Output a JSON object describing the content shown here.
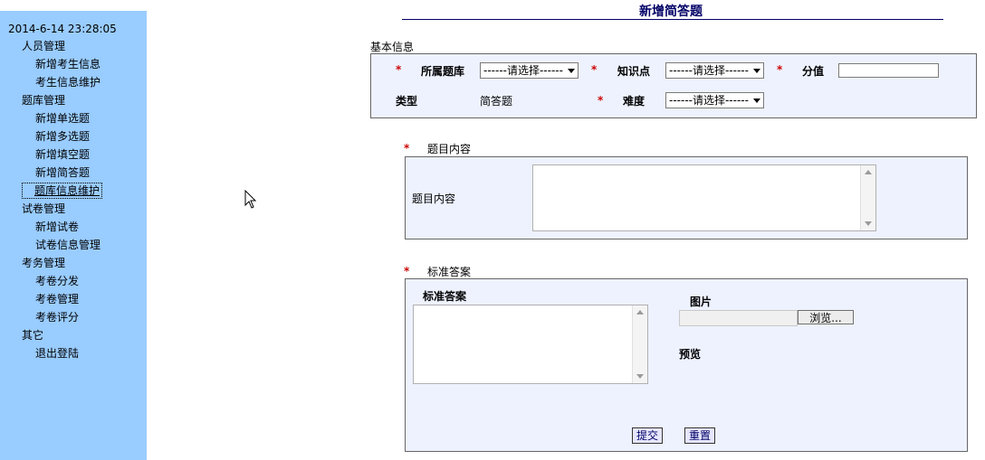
{
  "sidebar": {
    "timestamp": "2014-6-14 23:28:05",
    "groups": [
      {
        "label": "人员管理",
        "items": [
          "新增考生信息",
          "考生信息维护"
        ]
      },
      {
        "label": "题库管理",
        "items": [
          "新增单选题",
          "新增多选题",
          "新增填空题",
          "新增简答题",
          "题库信息维护"
        ]
      },
      {
        "label": "试卷管理",
        "items": [
          "新增试卷",
          "试卷信息管理"
        ]
      },
      {
        "label": "考务管理",
        "items": [
          "考卷分发",
          "考卷管理",
          "考卷评分"
        ]
      },
      {
        "label": "其它",
        "items": [
          "退出登陆"
        ]
      }
    ]
  },
  "page": {
    "title": "新增简答题"
  },
  "basic_info": {
    "section_label": "基本信息",
    "required_mark": "*",
    "bank_label": "所属题库",
    "bank_select": "------请选择------",
    "knowledge_label": "知识点",
    "knowledge_select": "------请选择------",
    "score_label": "分值",
    "score_value": "",
    "type_label": "类型",
    "type_value": "简答题",
    "difficulty_label": "难度",
    "difficulty_select": "------请选择------"
  },
  "question": {
    "section_label": "题目内容",
    "field_label": "题目内容",
    "content": ""
  },
  "answer": {
    "section_label": "标准答案",
    "answer_label": "标准答案",
    "answer_text": "",
    "image_label": "图片",
    "browse_button": "浏览...",
    "preview_label": "预览",
    "submit_button": "提交",
    "reset_button": "重置"
  }
}
